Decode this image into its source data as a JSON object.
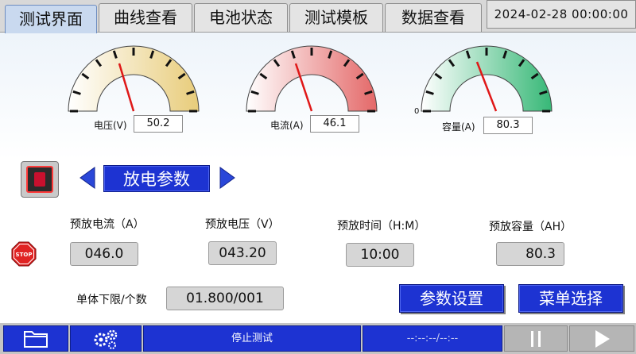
{
  "tabs": [
    {
      "label": "测试界面",
      "active": true
    },
    {
      "label": "曲线查看",
      "active": false
    },
    {
      "label": "电池状态",
      "active": false
    },
    {
      "label": "测试模板",
      "active": false
    },
    {
      "label": "数据查看",
      "active": false
    }
  ],
  "datetime": "2024-02-28    00:00:00",
  "gauges": [
    {
      "label": "电压(V)",
      "value": "50.2"
    },
    {
      "label": "电流(A)",
      "value": "46.1"
    },
    {
      "label": "容量(A)",
      "value": "80.3",
      "zero": "0"
    }
  ],
  "mode": {
    "title": "放电参数"
  },
  "params": [
    {
      "label": "预放电流（A）",
      "value": "046.0"
    },
    {
      "label": "预放电压（V）",
      "value": "043.20"
    },
    {
      "label": "预放时间（H:M）",
      "value": "10:00"
    },
    {
      "label": "预放容量（AH）",
      "value": "80.3"
    }
  ],
  "cell_limit": {
    "label": "单体下限/个数",
    "value": "01.800/001"
  },
  "stop_icon_text": "STOP",
  "buttons": {
    "param_settings": "参数设置",
    "menu_select": "菜单选择"
  },
  "bottom": {
    "status": "停止测试",
    "time": "--:--:--/--:--"
  },
  "colors": {
    "accent_blue": "#1d33d2",
    "gauge_voltage": "#e8cc7a",
    "gauge_current": "#e46868",
    "gauge_capacity": "#37b877"
  },
  "icons": [
    "folder-icon",
    "settings-gears-icon",
    "pause-icon",
    "play-icon",
    "stop-sign-icon",
    "arrow-left-icon",
    "arrow-right-icon"
  ]
}
